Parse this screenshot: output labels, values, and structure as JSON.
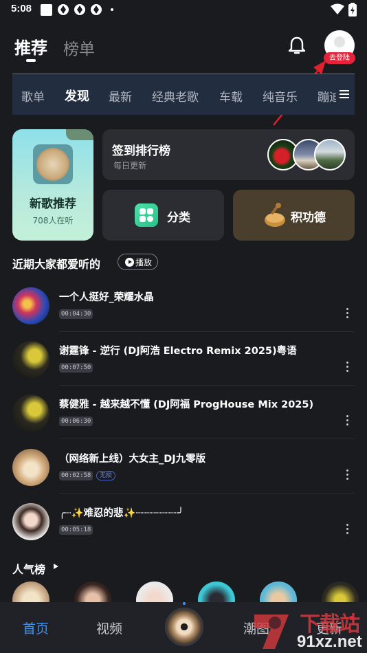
{
  "status_bar": {
    "time": "5:08"
  },
  "header": {
    "tabs": [
      {
        "label": "推荐",
        "active": true
      },
      {
        "label": "榜单",
        "active": false
      }
    ],
    "login_badge": "去登陆"
  },
  "category_nav": {
    "items": [
      "歌单",
      "发现",
      "最新",
      "经典老歌",
      "车载",
      "纯音乐",
      "蹦迪"
    ],
    "active": "发现"
  },
  "feature_cards": {
    "new_songs": {
      "title": "新歌推荐",
      "listeners": "708人在听"
    },
    "checkin": {
      "title": "签到排行榜",
      "subtitle": "每日更新"
    },
    "category": {
      "label": "分类"
    },
    "merit": {
      "label": "积功德"
    }
  },
  "recent": {
    "title": "近期大家都爱听的",
    "play_label": "播放",
    "songs": [
      {
        "title": "一个人挺好_荣耀水晶",
        "duration": "00:04:30",
        "tag": ""
      },
      {
        "title": "谢霆锋 - 逆行 (DJ阿浩 Electro Remix 2025)粤语",
        "duration": "00:07:50",
        "tag": ""
      },
      {
        "title": "蔡健雅 - 越来越不懂 (DJ阿福 ProgHouse Mix 2025)",
        "duration": "00:06:30",
        "tag": ""
      },
      {
        "title": "（网络新上线）大女主_DJ九零版",
        "duration": "00:02:58",
        "tag": "无损"
      },
      {
        "title": "╭┈✨难忍的悲✨┈┈┈┈┈┈┈╯",
        "duration": "00:05:18",
        "tag": ""
      }
    ]
  },
  "popular": {
    "title": "人气榜"
  },
  "bottom_nav": {
    "items": [
      {
        "label": "首页",
        "active": true
      },
      {
        "label": "视频",
        "active": false
      },
      {
        "label": "潮图",
        "active": false
      },
      {
        "label": "更新",
        "active": false
      }
    ]
  },
  "watermark": {
    "text": "91xz.net",
    "text_cn": "下载站"
  },
  "colors": {
    "accent": "#3e94f0",
    "badge_red": "#e8213a",
    "background": "#1a1b1f"
  }
}
